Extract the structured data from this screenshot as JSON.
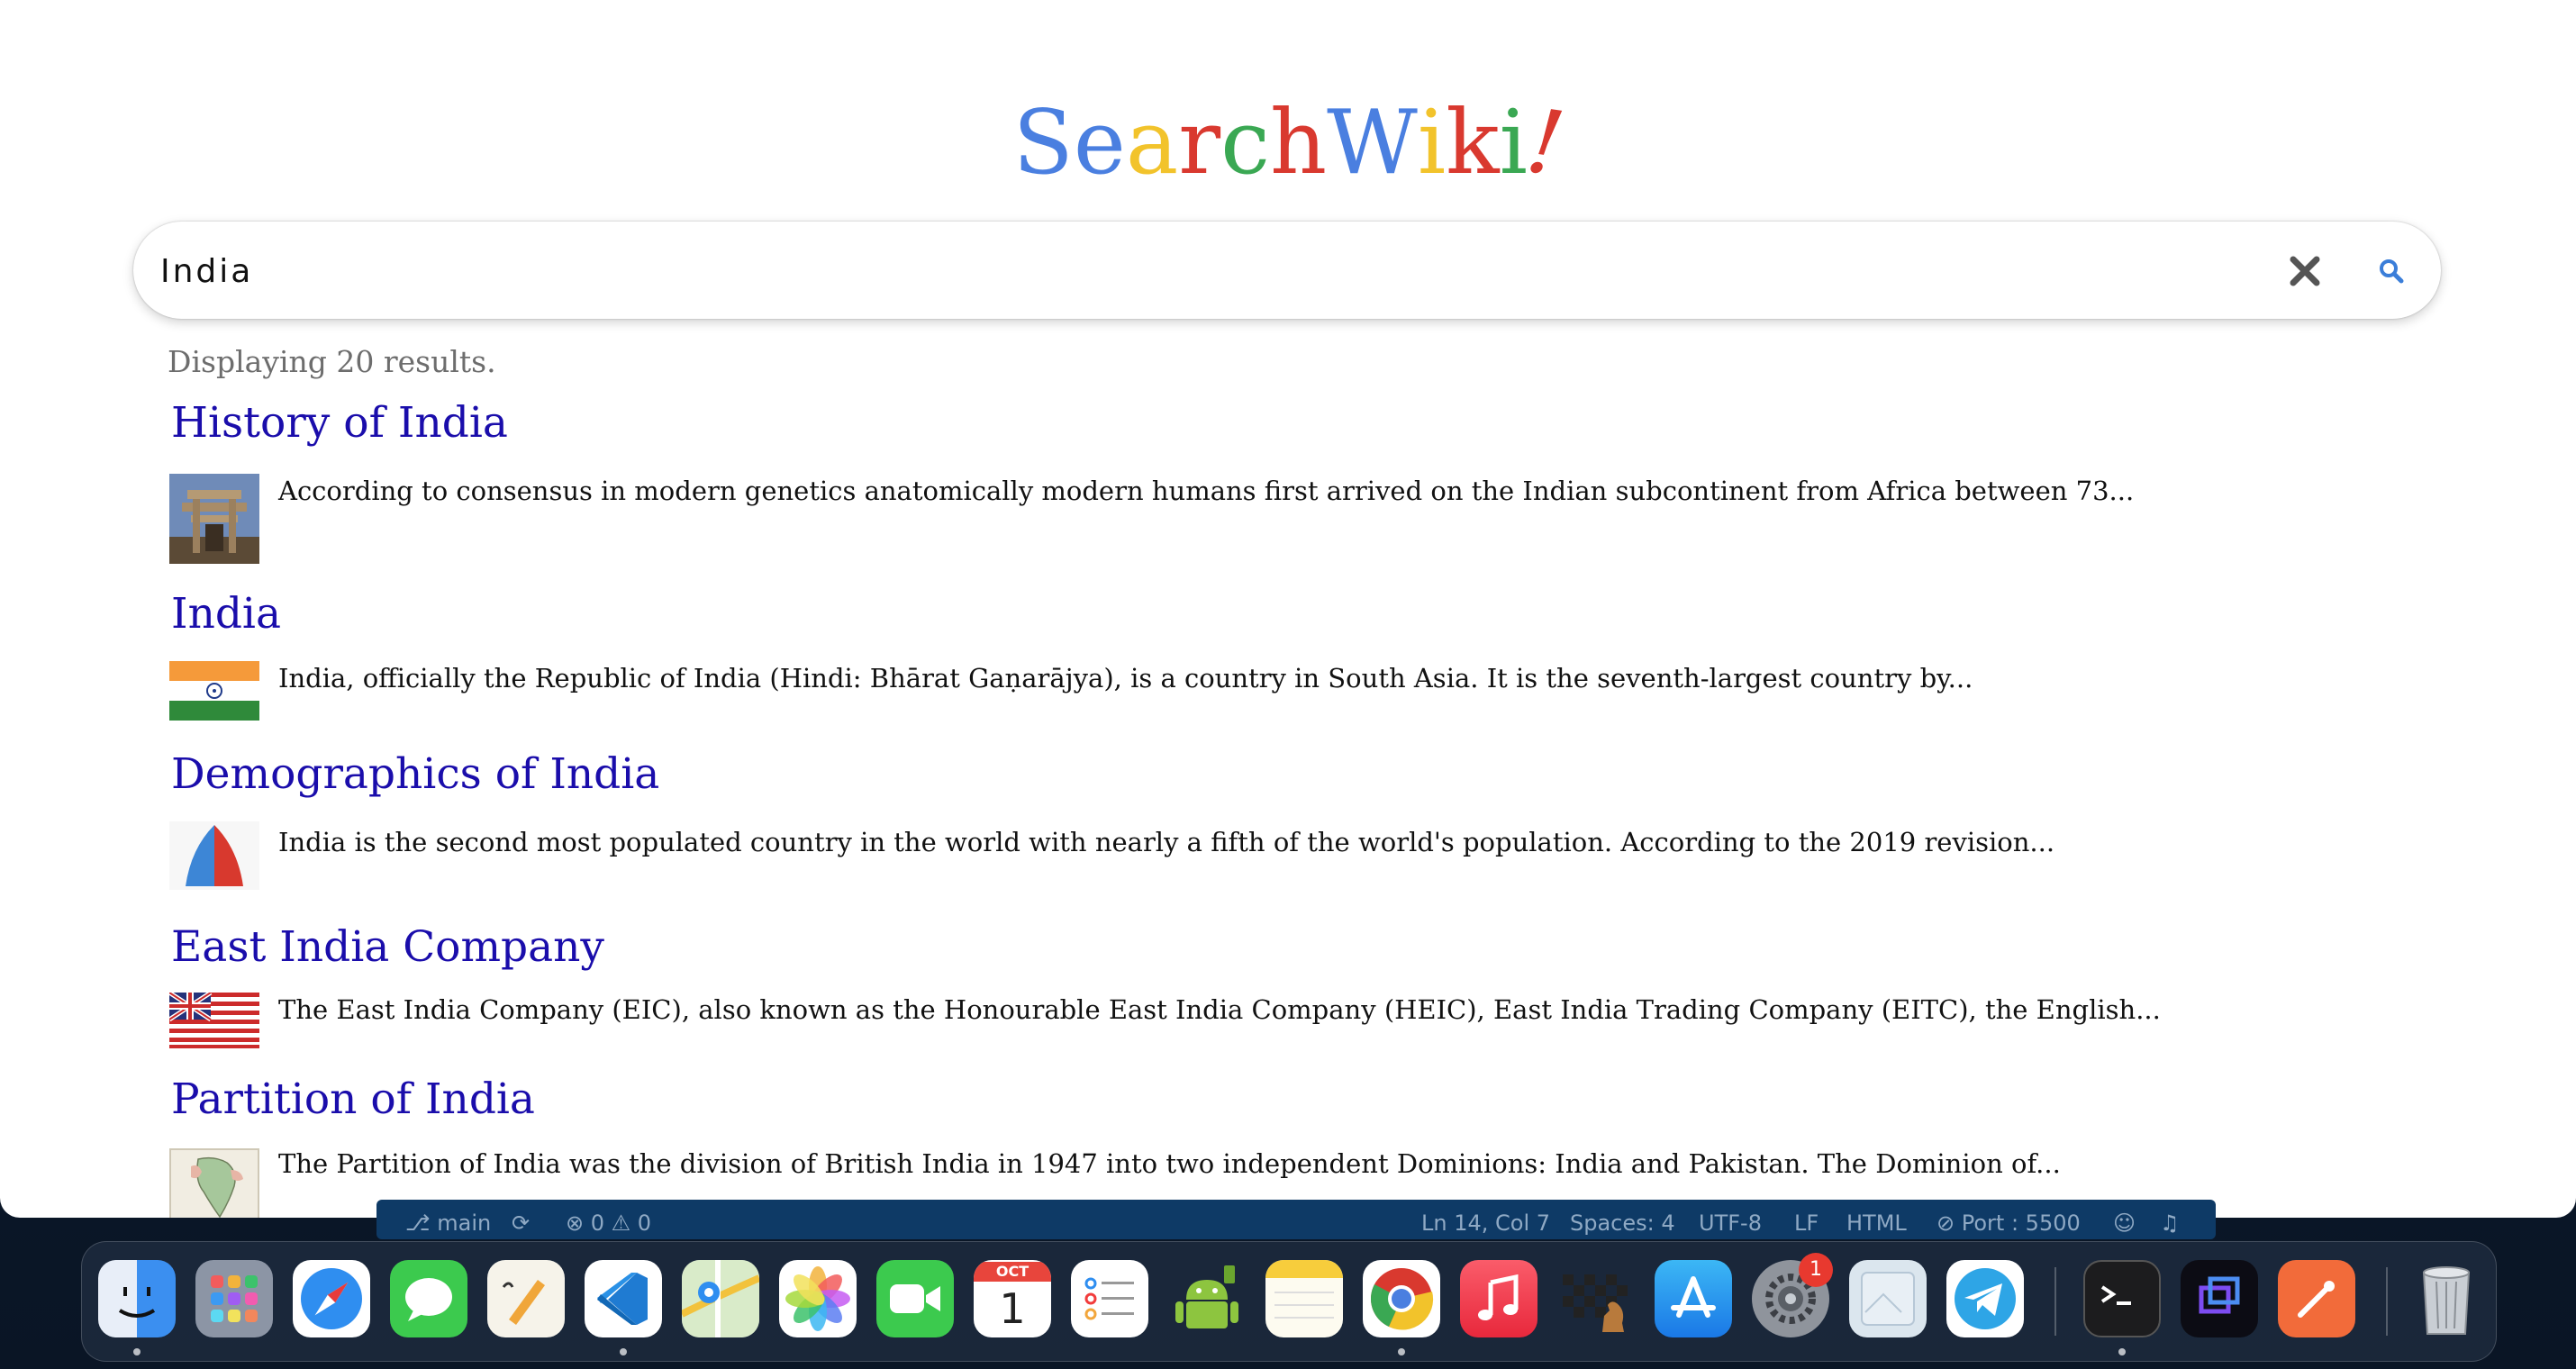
{
  "app": {
    "logo": {
      "letters": [
        {
          "ch": "S",
          "color": "#4a7fe0"
        },
        {
          "ch": "e",
          "color": "#4a7fe0"
        },
        {
          "ch": "a",
          "color": "#f2c32b"
        },
        {
          "ch": "r",
          "color": "#d9392f"
        },
        {
          "ch": "c",
          "color": "#3aa853"
        },
        {
          "ch": "h",
          "color": "#d9392f"
        },
        {
          "ch": "W",
          "color": "#4a7fe0"
        },
        {
          "ch": "i",
          "color": "#f2c32b"
        },
        {
          "ch": "k",
          "color": "#d9392f"
        },
        {
          "ch": "i",
          "color": "#3aa853"
        },
        {
          "ch": "!",
          "color": "#d9392f"
        }
      ]
    },
    "search": {
      "value": "India",
      "clear_icon": "close-icon",
      "search_icon": "search-icon"
    },
    "results_count_text": "Displaying 20 results.",
    "results": [
      {
        "title": "History of India",
        "snippet": "According to consensus in modern genetics anatomically modern humans first arrived on the Indian subcontinent from Africa between 73...",
        "thumb": "stupa-gateway-image"
      },
      {
        "title": "India",
        "snippet": "India, officially the Republic of India (Hindi: Bhārat Gaṇarājya), is a country in South Asia. It is the seventh-largest country by...",
        "thumb": "india-flag-image"
      },
      {
        "title": "Demographics of India",
        "snippet": "India is the second most populated country in the world with nearly a fifth of the world's population. According to the 2019 revision...",
        "thumb": "population-pyramid-image"
      },
      {
        "title": "East India Company",
        "snippet": "The East India Company (EIC), also known as the Honourable East India Company (HEIC), East India Trading Company (EITC), the English...",
        "thumb": "company-flag-image"
      },
      {
        "title": "Partition of India",
        "snippet": "The Partition of India was the division of British India in 1947 into two independent Dominions: India and Pakistan. The Dominion of...",
        "thumb": "partition-map-image"
      }
    ],
    "colors": {
      "link": "#1a0dab",
      "muted": "#6d6d6d"
    }
  },
  "vscode_status": {
    "branch": "main",
    "problems": "0 ⚠ 0",
    "cursor": "Ln 14, Col 7",
    "spaces": "Spaces: 4",
    "encoding": "UTF-8",
    "eol": "LF",
    "language": "HTML",
    "port": "Port : 5500"
  },
  "dock": {
    "apps": [
      {
        "name": "finder",
        "icon": "finder-icon",
        "running": true
      },
      {
        "name": "launchpad",
        "icon": "launchpad-icon",
        "running": false
      },
      {
        "name": "safari",
        "icon": "safari-icon",
        "running": false
      },
      {
        "name": "messages",
        "icon": "messages-icon",
        "running": false
      },
      {
        "name": "pages",
        "icon": "pages-icon",
        "running": false
      },
      {
        "name": "vscode",
        "icon": "vscode-icon",
        "running": true
      },
      {
        "name": "maps",
        "icon": "maps-icon",
        "running": false
      },
      {
        "name": "photos",
        "icon": "photos-icon",
        "running": false
      },
      {
        "name": "facetime",
        "icon": "facetime-icon",
        "running": false
      },
      {
        "name": "calendar",
        "icon": "calendar-icon",
        "running": false,
        "month": "OCT",
        "day": "1"
      },
      {
        "name": "reminders",
        "icon": "reminders-icon",
        "running": false
      },
      {
        "name": "android-studio",
        "icon": "android-icon",
        "running": false
      },
      {
        "name": "notes",
        "icon": "notes-icon",
        "running": false
      },
      {
        "name": "chrome",
        "icon": "chrome-icon",
        "running": true
      },
      {
        "name": "music",
        "icon": "music-icon",
        "running": false
      },
      {
        "name": "chess",
        "icon": "chess-icon",
        "running": false
      },
      {
        "name": "app-store",
        "icon": "app-store-icon",
        "running": false
      },
      {
        "name": "system-settings",
        "icon": "settings-icon",
        "running": false,
        "badge": "1"
      },
      {
        "name": "preview",
        "icon": "preview-icon",
        "running": false
      },
      {
        "name": "telegram",
        "icon": "telegram-icon",
        "running": false
      },
      {
        "name": "terminal",
        "icon": "terminal-icon",
        "running": true
      },
      {
        "name": "screen-tool",
        "icon": "screen-tool-icon",
        "running": false
      },
      {
        "name": "postman",
        "icon": "postman-icon",
        "running": false
      },
      {
        "name": "trash",
        "icon": "trash-icon",
        "running": false
      }
    ]
  }
}
